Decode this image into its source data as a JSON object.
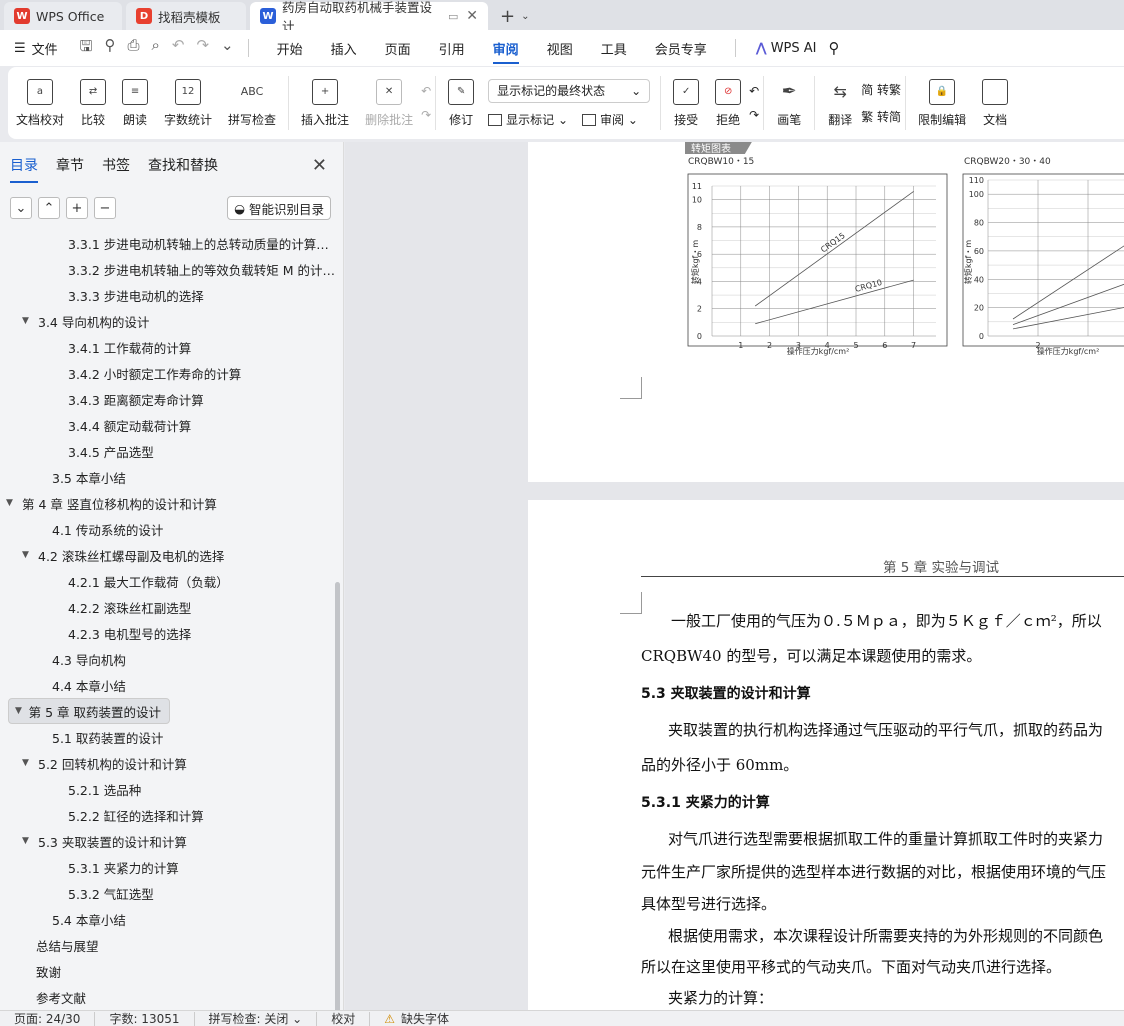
{
  "tabs": [
    {
      "label": "WPS Office"
    },
    {
      "label": "找稻壳模板"
    },
    {
      "label": "药房自动取药机械手装置设计"
    }
  ],
  "menu": {
    "file": "文件",
    "items": [
      "开始",
      "插入",
      "页面",
      "引用",
      "审阅",
      "视图",
      "工具",
      "会员专享"
    ],
    "active": "审阅",
    "ai": "WPS AI"
  },
  "ribbon": {
    "proofread": "文档校对",
    "compare": "比较",
    "read_aloud": "朗读",
    "word_count": "字数统计",
    "spell_check": "拼写检查",
    "insert_comment": "插入批注",
    "delete_comment": "删除批注",
    "revise": "修订",
    "markup_state": "显示标记的最终状态",
    "show_markup": "显示标记",
    "review": "审阅",
    "accept": "接受",
    "reject": "拒绝",
    "pen": "画笔",
    "translate": "翻译",
    "to_traditional": "转繁",
    "to_simplified": "转简",
    "restrict_edit": "限制编辑",
    "doc_rights": "文档"
  },
  "sidebar": {
    "tabs": [
      "目录",
      "章节",
      "书签",
      "查找和替换"
    ],
    "smart_button": "智能识别目录",
    "toc": [
      {
        "label": "3.3.1 步进电动机转轴上的总转动质量的计算…",
        "level": 3,
        "arrow": ""
      },
      {
        "label": "3.3.2 步进电机转轴上的等效负载转矩 M 的计…",
        "level": 3,
        "arrow": ""
      },
      {
        "label": "3.3.3 步进电动机的选择",
        "level": 3,
        "arrow": ""
      },
      {
        "label": "3.4 导向机构的设计",
        "level": 2,
        "arrow": "▼"
      },
      {
        "label": "3.4.1  工作载荷的计算",
        "level": 3,
        "arrow": ""
      },
      {
        "label": "3.4.2 小时额定工作寿命的计算",
        "level": 3,
        "arrow": ""
      },
      {
        "label": "3.4.3 距离额定寿命计算",
        "level": 3,
        "arrow": ""
      },
      {
        "label": "3.4.4 额定动载荷计算",
        "level": 3,
        "arrow": ""
      },
      {
        "label": "3.4.5  产品选型",
        "level": 3,
        "arrow": ""
      },
      {
        "label": "3.5 本章小结",
        "level": 2,
        "arrow": ""
      },
      {
        "label": "第 4 章  竖直位移机构的设计和计算",
        "level": 1,
        "arrow": "▼"
      },
      {
        "label": "4.1 传动系统的设计",
        "level": 2,
        "arrow": ""
      },
      {
        "label": "4.2 滚珠丝杠螺母副及电机的选择",
        "level": 2,
        "arrow": "▼"
      },
      {
        "label": "4.2.1 最大工作载荷（负载）",
        "level": 3,
        "arrow": ""
      },
      {
        "label": "4.2.2 滚珠丝杠副选型",
        "level": 3,
        "arrow": ""
      },
      {
        "label": "4.2.3 电机型号的选择",
        "level": 3,
        "arrow": ""
      },
      {
        "label": "4.3  导向机构",
        "level": 2,
        "arrow": ""
      },
      {
        "label": "4.4  本章小结",
        "level": 2,
        "arrow": ""
      },
      {
        "label": "第 5 章  取药装置的设计",
        "level": 1,
        "arrow": "▼",
        "selected": true
      },
      {
        "label": "5.1 取药装置的设计",
        "level": 2,
        "arrow": ""
      },
      {
        "label": "5.2  回转机构的设计和计算",
        "level": 2,
        "arrow": "▼"
      },
      {
        "label": "5.2.1 选品种",
        "level": 3,
        "arrow": ""
      },
      {
        "label": "5.2.2 缸径的选择和计算",
        "level": 3,
        "arrow": ""
      },
      {
        "label": "5.3  夹取装置的设计和计算",
        "level": 2,
        "arrow": "▼"
      },
      {
        "label": "5.3.1  夹紧力的计算",
        "level": 3,
        "arrow": ""
      },
      {
        "label": "5.3.2  气缸选型",
        "level": 3,
        "arrow": ""
      },
      {
        "label": "5.4  本章小结",
        "level": 2,
        "arrow": ""
      },
      {
        "label": "总结与展望",
        "level": 1,
        "arrow": ""
      },
      {
        "label": "致谢",
        "level": 1,
        "arrow": ""
      },
      {
        "label": "参考文献",
        "level": 1,
        "arrow": ""
      }
    ]
  },
  "document": {
    "figure_tag": "转矩图表",
    "chapter_header": "第 5 章  实验与调试",
    "lines": [
      "一般工厂使用的气压为０.５Ｍｐａ，即为５Ｋｇｆ／ｃｍ²，所以",
      "CRQBW40 的型号，可以满足本课题使用的需求。",
      "5.3  夹取装置的设计和计算",
      "夹取装置的执行机构选择通过气压驱动的平行气爪，抓取的药品为",
      "品的外径小于 60mm。",
      "5.3.1  夹紧力的计算",
      "对气爪进行选型需要根据抓取工件的重量计算抓取工件时的夹紧力",
      "元件生产厂家所提供的选型样本进行数据的对比，根据使用环境的气压",
      "具体型号进行选择。",
      "根据使用需求，本次课程设计所需要夹持的为外形规则的不同颜色",
      "所以在这里使用平移式的气动夹爪。下面对气动夹爪进行选择。",
      "夹紧力的计算："
    ]
  },
  "chart_data": [
    {
      "type": "line",
      "title": "CRQBW10・15",
      "xlabel": "操作压力kgf/cm²",
      "ylabel": "转矩kgf・m",
      "xlim": [
        0,
        7.5
      ],
      "ylim": [
        0,
        11
      ],
      "x_ticks": [
        "1",
        "2",
        "3",
        "4",
        "5",
        "6",
        "7"
      ],
      "y_ticks": [
        "0",
        "2",
        "4",
        "6",
        "8",
        "10",
        "11"
      ],
      "series": [
        {
          "name": "CRQ15",
          "x": [
            1.5,
            7
          ],
          "y": [
            2.2,
            10.6
          ]
        },
        {
          "name": "CRQ10",
          "x": [
            1.5,
            7
          ],
          "y": [
            0.9,
            4.1
          ]
        }
      ]
    },
    {
      "type": "line",
      "title": "CRQBW20・30・40",
      "xlabel": "操作压力kgf/cm²",
      "ylabel": "转矩kgf・m",
      "ylim": [
        0,
        110
      ],
      "y_ticks": [
        "0",
        "20",
        "40",
        "60",
        "80",
        "100",
        "110"
      ],
      "x_ticks": [
        "2"
      ],
      "series": [
        {
          "x": [
            1.5,
            4
          ],
          "y": [
            12,
            70
          ]
        },
        {
          "x": [
            1.5,
            4
          ],
          "y": [
            8,
            40
          ]
        },
        {
          "x": [
            1.5,
            4
          ],
          "y": [
            5,
            22
          ]
        }
      ]
    }
  ],
  "status": {
    "page": "页面: 24/30",
    "words": "字数: 13051",
    "spell": "拼写检查: 关闭",
    "proof": "校对",
    "missing_font": "缺失字体"
  }
}
